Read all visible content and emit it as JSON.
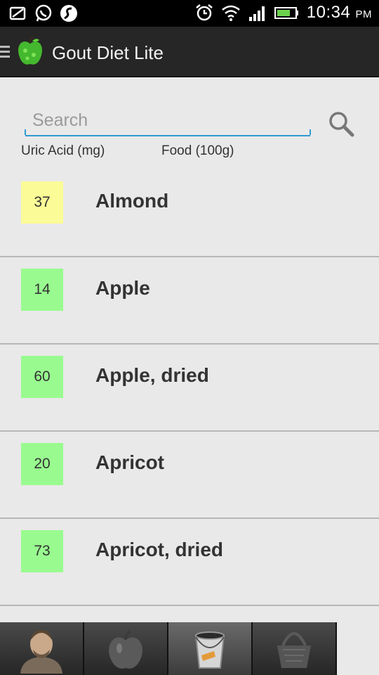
{
  "status_bar": {
    "time": "10:34",
    "ampm": "PM",
    "icons": [
      "notification-icon",
      "whatsapp-icon",
      "swype-icon",
      "alarm-icon",
      "wifi-icon",
      "signal-icon",
      "battery-icon"
    ]
  },
  "app_bar": {
    "title": "Gout Diet Lite",
    "logo_icon": "apple-logo-icon"
  },
  "search": {
    "placeholder": "Search",
    "value": ""
  },
  "columns": {
    "uric_acid": "Uric Acid (mg)",
    "food": "Food (100g)"
  },
  "foods": [
    {
      "uric_acid": "37",
      "name": "Almond",
      "level": "medium"
    },
    {
      "uric_acid": "14",
      "name": "Apple",
      "level": "low"
    },
    {
      "uric_acid": "60",
      "name": "Apple, dried",
      "level": "low"
    },
    {
      "uric_acid": "20",
      "name": "Apricot",
      "level": "low"
    },
    {
      "uric_acid": "73",
      "name": "Apricot, dried",
      "level": "low"
    }
  ],
  "level_colors": {
    "low": "#99fb8f",
    "medium": "#fbfb97"
  },
  "tabs": [
    {
      "icon": "man-avatar-icon",
      "active": false
    },
    {
      "icon": "apple-icon",
      "active": false
    },
    {
      "icon": "bucket-icon",
      "active": true
    },
    {
      "icon": "basket-icon",
      "active": false
    }
  ]
}
